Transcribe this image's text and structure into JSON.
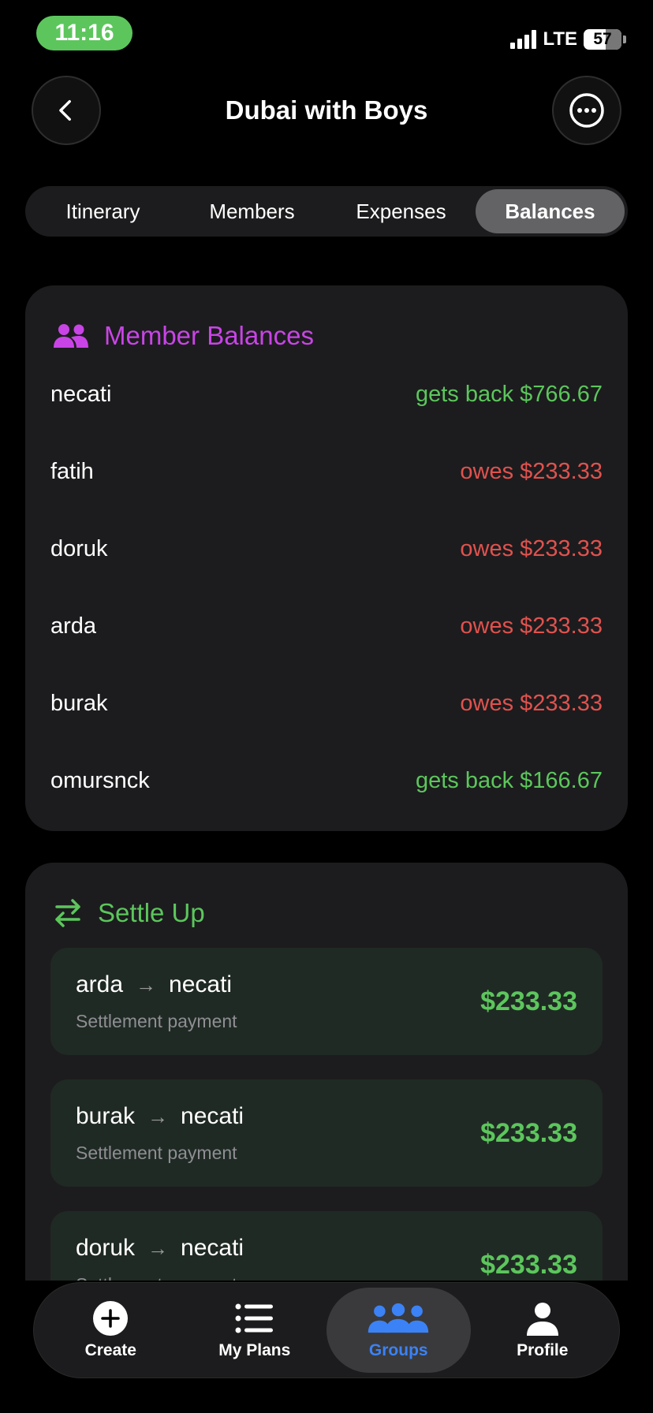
{
  "status_bar": {
    "time": "11:16",
    "network": "LTE",
    "battery": "57"
  },
  "header": {
    "title": "Dubai with Boys"
  },
  "tabs": [
    {
      "label": "Itinerary",
      "active": false
    },
    {
      "label": "Members",
      "active": false
    },
    {
      "label": "Expenses",
      "active": false
    },
    {
      "label": "Balances",
      "active": true
    }
  ],
  "member_balances": {
    "title": "Member Balances",
    "accent": "#c944e6",
    "rows": [
      {
        "name": "necati",
        "amount": "gets back $766.67",
        "status": "positive"
      },
      {
        "name": "fatih",
        "amount": "owes $233.33",
        "status": "negative"
      },
      {
        "name": "doruk",
        "amount": "owes $233.33",
        "status": "negative"
      },
      {
        "name": "arda",
        "amount": "owes $233.33",
        "status": "negative"
      },
      {
        "name": "burak",
        "amount": "owes $233.33",
        "status": "negative"
      },
      {
        "name": "omursnck",
        "amount": "gets back $166.67",
        "status": "positive"
      }
    ]
  },
  "settle_up": {
    "title": "Settle Up",
    "accent": "#5cc65c",
    "items": [
      {
        "from": "arda",
        "to": "necati",
        "subtitle": "Settlement payment",
        "amount": "$233.33"
      },
      {
        "from": "burak",
        "to": "necati",
        "subtitle": "Settlement payment",
        "amount": "$233.33"
      },
      {
        "from": "doruk",
        "to": "necati",
        "subtitle": "Settlement payment",
        "amount": "$233.33"
      }
    ]
  },
  "bottom_nav": [
    {
      "label": "Create",
      "icon": "plus-circle-icon",
      "active": false
    },
    {
      "label": "My Plans",
      "icon": "list-icon",
      "active": false
    },
    {
      "label": "Groups",
      "icon": "people-icon",
      "active": true
    },
    {
      "label": "Profile",
      "icon": "person-icon",
      "active": false
    }
  ],
  "colors": {
    "positive": "#5cc65c",
    "negative": "#e0524e",
    "nav_active": "#3b82f6",
    "card_bg": "#1c1c1e"
  }
}
